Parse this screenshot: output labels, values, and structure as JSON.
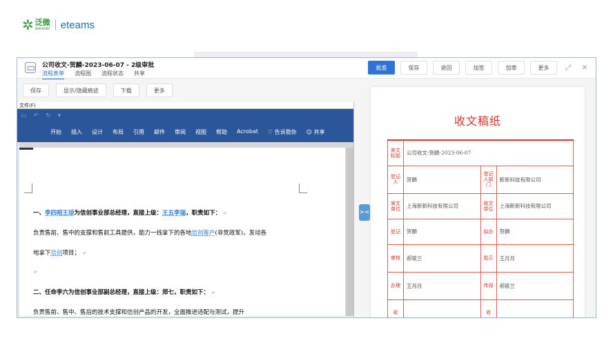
{
  "brand": {
    "cn": "泛微",
    "en": "weaver",
    "product": "eteams"
  },
  "window": {
    "title": "公司收文-贺麟-2023-06-07 - 2级审批",
    "tabs": [
      "流程表单",
      "流程图",
      "流程状态",
      "共享"
    ],
    "actions": [
      "批准",
      "保存",
      "退回",
      "加签",
      "加审",
      "更多"
    ]
  },
  "toolbar": {
    "buttons": [
      "保存",
      "显示/隐藏痕迹",
      "下载",
      "更多"
    ]
  },
  "word": {
    "file_menu": "文件(F)",
    "ribbon_tabs": [
      "开始",
      "插入",
      "设计",
      "布局",
      "引用",
      "邮件",
      "审阅",
      "视图",
      "帮助",
      "Acrobat",
      "告诉我你",
      "共享"
    ],
    "lines": {
      "l1_a": "一、",
      "l1_b": "李四昭王琼",
      "l1_c": "为信创事业部总经理，直接上级：",
      "l1_d": "王五李瑞",
      "l1_e": "，职责如下：",
      "l2_a": "负责售前、售中的支撑和售前工具提供，助力一线拿下的各地",
      "l2_b": "信创客户",
      "l2_c": "(非党政军)，发动各",
      "l3_a": "地拿下",
      "l3_b": "信创",
      "l3_c": "项目；",
      "l5": "二、任命李六为信创事业部副总经理，直接上级：郑七，职责如下：",
      "l6": "负责售前、售中、售后的技术支撑和信创产品的开发，全面推进适配与测试，提升"
    }
  },
  "form": {
    "title": "收文稿纸",
    "rows": [
      {
        "label1": "来文标题",
        "value1": "公司收文-贺麟-2023-06-07"
      },
      {
        "label1": "登记人",
        "value1": "贺麟",
        "label2": "登记人部门",
        "value2": "新新科技有限公司"
      },
      {
        "label1": "来文单位",
        "value1": "上海新新科技有限公司",
        "label2": "收文单位",
        "value2": "上海新新科技有限公司"
      },
      {
        "label1": "登记",
        "value1": "贺麟",
        "label2": "拟办",
        "value2": "贺麟"
      },
      {
        "label1": "审核",
        "value1": "郝筱兰",
        "label2": "批示",
        "value2": "王月月"
      },
      {
        "label1": "办理",
        "value1": "王月月",
        "label2": "传阅",
        "value2": "郝筱兰"
      },
      {
        "label1": "收",
        "value1": "",
        "label2": "收",
        "value2": ""
      }
    ]
  }
}
